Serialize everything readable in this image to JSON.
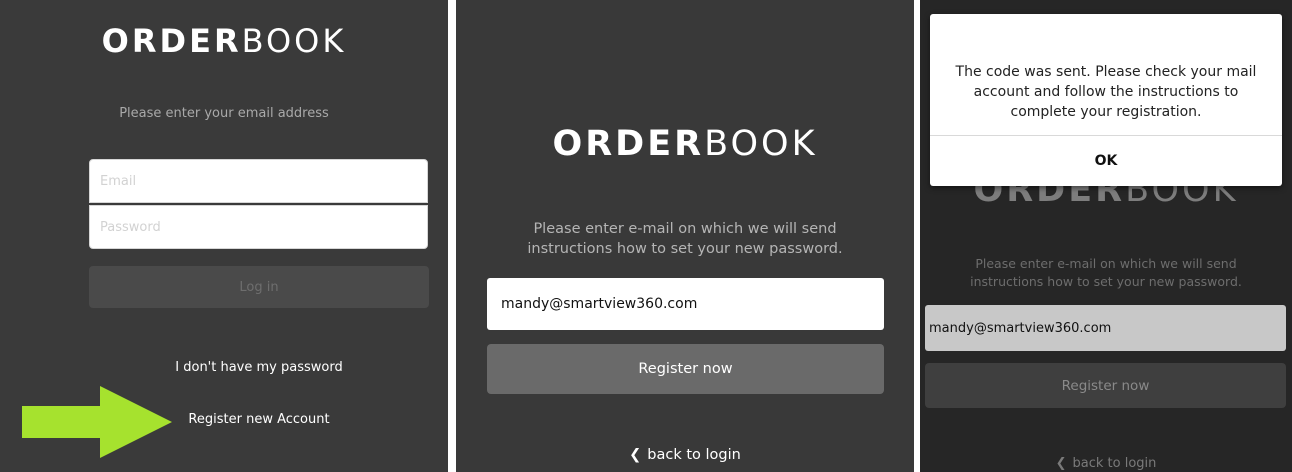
{
  "panel1": {
    "logo_bold": "ORDER",
    "logo_light": "BOOK",
    "prompt": "Please enter your email address",
    "email_placeholder": "Email",
    "password_placeholder": "Password",
    "login_label": "Log in",
    "forgot_label": "I don't have my password",
    "register_label": "Register new Account",
    "arrow_color": "#a6e22e"
  },
  "panel2": {
    "logo_bold": "ORDER",
    "logo_light": "BOOK",
    "prompt_line1": "Please enter e-mail on which we will send",
    "prompt_line2": "instructions how to set your new password.",
    "email_value": "mandy@smartview360.com",
    "register_label": "Register now",
    "back_label": "back to login"
  },
  "panel3": {
    "logo_bold": "ORDER",
    "logo_light": "BOOK",
    "prompt_line1": "Please enter e-mail on which we will send",
    "prompt_line2": "instructions how to set your new password.",
    "email_value": "mandy@smartview360.com",
    "register_label": "Register now",
    "back_label": "back to login",
    "dialog": {
      "line1": "The code was sent. Please check your mail",
      "line2": "account and follow the instructions to",
      "line3": "complete your registration.",
      "ok_label": "OK"
    }
  }
}
